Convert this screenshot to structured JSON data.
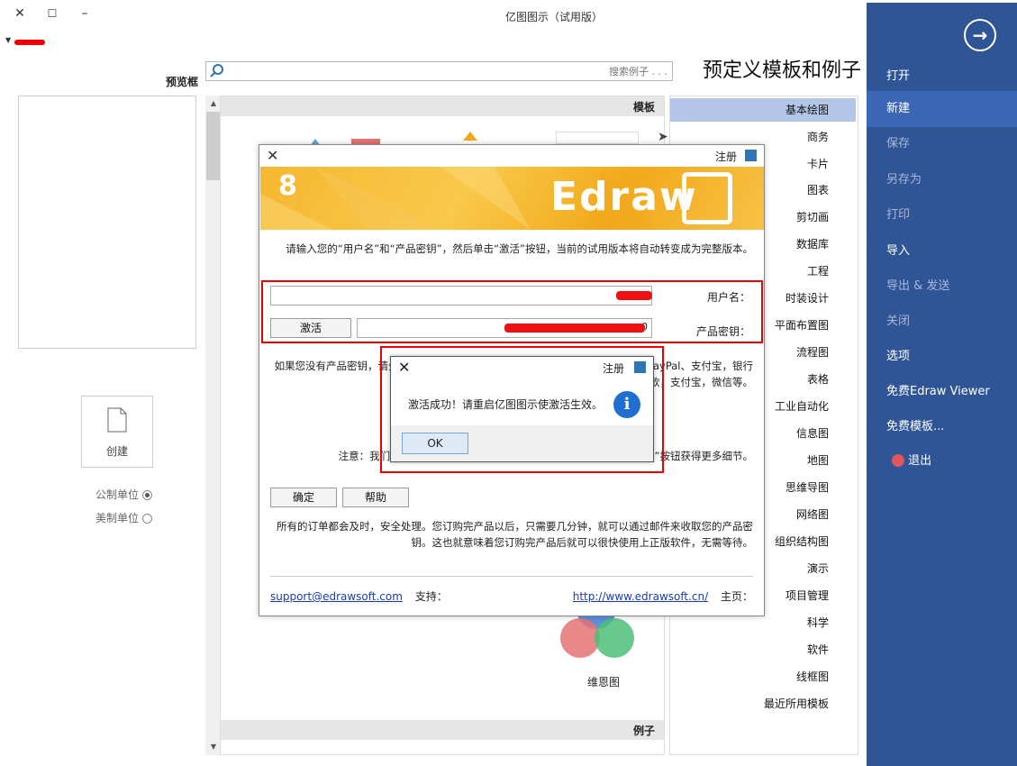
{
  "window": {
    "title": "亿图图示（试用版）",
    "close_glyph": "✕",
    "restore_glyph": "☐",
    "minimize_glyph": "–"
  },
  "sidebar": {
    "back_glyph": "→",
    "items": [
      {
        "label": "打开",
        "state": "normal"
      },
      {
        "label": "新建",
        "state": "active"
      },
      {
        "label": "保存",
        "state": "dim"
      },
      {
        "label": "另存为",
        "state": "dim"
      },
      {
        "label": "打印",
        "state": "dim"
      },
      {
        "label": "导入",
        "state": "normal"
      },
      {
        "label": "导出 & 发送",
        "state": "dim"
      },
      {
        "label": "关闭",
        "state": "dim"
      },
      {
        "label": "选项",
        "state": "normal"
      },
      {
        "label": "免费Edraw Viewer",
        "state": "normal"
      },
      {
        "label": "免费模板...",
        "state": "normal"
      },
      {
        "label": "退出",
        "state": "normal"
      }
    ],
    "colors": {
      "bg": "#2f5597",
      "active": "#3c67b7"
    }
  },
  "page": {
    "title": "预定义模板和例子"
  },
  "search": {
    "placeholder": "搜索例子 . . ."
  },
  "preview": {
    "label": "预览框",
    "create_label": "创建",
    "units": [
      "公制单位",
      "美制单位"
    ],
    "selected_unit": "公制单位"
  },
  "templates": {
    "section_label": "模板",
    "examples_label": "例子",
    "venn_label": "维恩图"
  },
  "categories": {
    "items": [
      "基本绘图",
      "商务",
      "卡片",
      "图表",
      "剪切画",
      "数据库",
      "工程",
      "时装设计",
      "平面布置图",
      "流程图",
      "表格",
      "工业自动化",
      "信息图",
      "地图",
      "思维导图",
      "网络图",
      "组织结构图",
      "演示",
      "项目管理",
      "科学",
      "软件",
      "线框图",
      "最近所用模板"
    ],
    "selected": "基本绘图"
  },
  "register_dialog": {
    "title": "注册",
    "banner_brand": "Edraw",
    "banner_version": "8",
    "instruction": "请输入您的“用户名”和“产品密钥”，然后单击“激活”按钮，当前的试用版本将自动转变成为完整版本。",
    "username_label": "用户名：",
    "key_label": "产品密钥：",
    "key_prefix": "0",
    "activate_label": "激活",
    "paragraph1": "如果您没有产品密钥，请先购买。我们支持多种付款方式，包括信用卡、支付宝、PayPal、支付宝，银行汇款，支付宝，微信等。",
    "paragraph2": "注意：我们直接在线销售，您也可以通过支付宝，微信等。点击“帮助”按钮获得更多细节。",
    "help_label": "帮助",
    "ok_label": "确定",
    "paragraph3": "所有的订单都会及时，安全处理。您订购完产品以后，只需要几分钟，就可以通过邮件来收取您的产品密钥。这也就意味着您订购完产品后就可以很快使用上正版软件，无需等待。",
    "homepage_label": "主页：",
    "homepage_url": "http://www.edrawsoft.cn/",
    "support_label": "支持：",
    "support_email": "support@edrawsoft.com"
  },
  "message_dialog": {
    "title": "注册",
    "message": "激活成功！请重启亿图图示使激活生效。",
    "ok_label": "OK",
    "info_glyph": "i"
  }
}
